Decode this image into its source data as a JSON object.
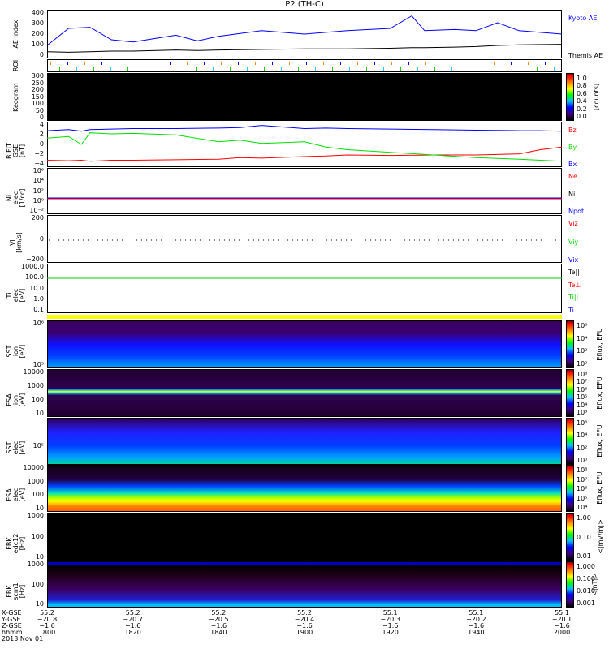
{
  "title": "P2 (TH-C)",
  "panels": {
    "ae": {
      "label": "AE Index",
      "ticks": [
        "400",
        "300",
        "200",
        "100",
        "0"
      ],
      "legend": [
        "Kyoto AE",
        "Themis AE"
      ]
    },
    "roi": {
      "label": "ROI"
    },
    "keogram": {
      "label": "Keogram",
      "ticks": [
        "300",
        "250",
        "200",
        "150",
        "100",
        "50",
        "0"
      ],
      "cbar_ticks": [
        "1.0",
        "0.8",
        "0.6",
        "0.4",
        "0.2",
        "0.0"
      ],
      "cbar_label": "[counts]"
    },
    "bfit": {
      "label": "B FIT\nGSE\n[nT]",
      "ticks": [
        "4",
        "2",
        "0",
        "−2",
        "−4"
      ],
      "legend": [
        "Bz",
        "By",
        "Bx"
      ]
    },
    "ni": {
      "label": "Ni\nelec\n[1/cc]",
      "ticks": [
        "10⁶",
        "10⁴",
        "10²",
        "10⁰",
        "10⁻²"
      ],
      "legend": [
        "Ne",
        "Ni",
        "Npot"
      ]
    },
    "vi": {
      "label": "Vi\n[km/s]",
      "ticks": [
        "200",
        "0",
        "−200"
      ],
      "legend": [
        "Viz",
        "Viy",
        "Vix"
      ]
    },
    "t": {
      "label": "Ti\nelec\n[eV]",
      "ticks": [
        "1000.0",
        "100.0",
        "10.0",
        "1.0",
        "0.1"
      ],
      "legend": [
        "Te||",
        "Te⊥",
        "Ti||",
        "Ti⊥"
      ]
    },
    "sst_i": {
      "label": "SST\nion\n[eV]",
      "ticks": [
        "10⁶",
        "10⁵"
      ],
      "cbar_ticks": [
        "10⁶",
        "10⁴",
        "10²",
        "10⁰"
      ],
      "cbar_label": "Eflux, EFU"
    },
    "esa_i": {
      "label": "ESA\nion\n[eV]",
      "ticks": [
        "10000",
        "1000",
        "100",
        "10"
      ],
      "cbar_ticks": [
        "10⁸",
        "10⁷",
        "10⁶",
        "10⁵",
        "10⁴",
        "10³"
      ],
      "cbar_label": "Eflux, EFU"
    },
    "sst_e": {
      "label": "SST\nelec\n[eV]",
      "ticks": [
        "10⁵"
      ],
      "cbar_ticks": [
        "10⁶",
        "10⁴",
        "10²",
        "10⁰"
      ],
      "cbar_label": "Eflux, EFU"
    },
    "esa_e": {
      "label": "ESA\nelec\n[eV]",
      "ticks": [
        "10000",
        "1000",
        "100",
        "10"
      ],
      "cbar_ticks": [
        "10⁸",
        "10⁷",
        "10⁶",
        "10⁵",
        "10⁴"
      ],
      "cbar_label": "Eflux, EFU"
    },
    "fbk1": {
      "label": "FBK\nedc12\n[Hz]",
      "ticks": [
        "1000",
        "100",
        "10"
      ],
      "cbar_ticks": [
        "1.00",
        "0.10",
        "0.01"
      ],
      "cbar_label": "<|mV/m|>"
    },
    "fbk2": {
      "label": "FBK\nscm1\n[Hz]",
      "ticks": [
        "1000",
        "100",
        "10"
      ],
      "cbar_ticks": [
        "1.000",
        "0.100",
        "0.010",
        "0.001"
      ],
      "cbar_label": "<|nT|>"
    }
  },
  "xaxis": {
    "row_labels": [
      "X-GSE",
      "Y-GSE",
      "Z-GSE",
      "hhmm"
    ],
    "date": "2013 Nov 01",
    "columns": [
      {
        "x": "55.2",
        "y": "−20.8",
        "z": "−1.6",
        "t": "1800"
      },
      {
        "x": "55.2",
        "y": "−20.7",
        "z": "−1.6",
        "t": "1820"
      },
      {
        "x": "55.2",
        "y": "−20.5",
        "z": "−1.6",
        "t": "1840"
      },
      {
        "x": "55.2",
        "y": "−20.4",
        "z": "−1.6",
        "t": "1900"
      },
      {
        "x": "55.1",
        "y": "−20.3",
        "z": "−1.6",
        "t": "1920"
      },
      {
        "x": "55.1",
        "y": "−20.2",
        "z": "−1.6",
        "t": "1940"
      },
      {
        "x": "55.1",
        "y": "−20.1",
        "z": "−1.6",
        "t": "2000"
      }
    ]
  },
  "colors": {
    "blue": "#0000ff",
    "red": "#ff0000",
    "green": "#00e000",
    "yellow": "#ffff00"
  },
  "chart_data": [
    {
      "type": "line",
      "title": "AE Index",
      "xlabel": "hhmm",
      "ylabel": "AE Index",
      "ylim": [
        0,
        400
      ],
      "x_minutes": [
        0,
        5,
        10,
        15,
        20,
        30,
        35,
        40,
        50,
        60,
        70,
        80,
        85,
        88,
        95,
        100,
        105,
        110,
        120
      ],
      "series": [
        {
          "name": "Kyoto AE",
          "color": "#0000ff",
          "values": [
            100,
            250,
            260,
            150,
            130,
            190,
            140,
            180,
            230,
            200,
            230,
            250,
            360,
            230,
            240,
            230,
            300,
            230,
            200
          ]
        },
        {
          "name": "Themis AE",
          "color": "#000000",
          "values": [
            45,
            40,
            45,
            50,
            50,
            60,
            55,
            60,
            65,
            70,
            70,
            75,
            80,
            80,
            85,
            90,
            100,
            105,
            110
          ]
        }
      ]
    },
    {
      "type": "line",
      "title": "B FIT GSE",
      "ylabel": "[nT]",
      "ylim": [
        -4,
        4
      ],
      "x_minutes": [
        0,
        5,
        8,
        10,
        15,
        20,
        30,
        40,
        45,
        50,
        60,
        65,
        70,
        80,
        90,
        100,
        110,
        115,
        120
      ],
      "series": [
        {
          "name": "Bz",
          "color": "#ff0000",
          "values": [
            -3,
            -3.1,
            -3,
            -3.2,
            -3,
            -3,
            -2.9,
            -2.8,
            -2.5,
            -2.6,
            -2.3,
            -2.2,
            -2,
            -2.1,
            -2,
            -2,
            -1.8,
            -1,
            -0.5
          ]
        },
        {
          "name": "By",
          "color": "#00e000",
          "values": [
            1.2,
            1.5,
            0,
            2.2,
            2,
            2.1,
            1.8,
            0.5,
            0.8,
            0.2,
            0.5,
            -0.5,
            -1,
            -1.5,
            -2,
            -2.5,
            -2.8,
            -3,
            -3.2
          ]
        },
        {
          "name": "Bx",
          "color": "#0000ff",
          "values": [
            2.6,
            2.8,
            2.5,
            2.8,
            2.9,
            3,
            3,
            3.1,
            3.2,
            3.6,
            3,
            3.1,
            3,
            2.9,
            2.8,
            2.7,
            2.6,
            2.6,
            2.5
          ]
        }
      ]
    }
  ]
}
